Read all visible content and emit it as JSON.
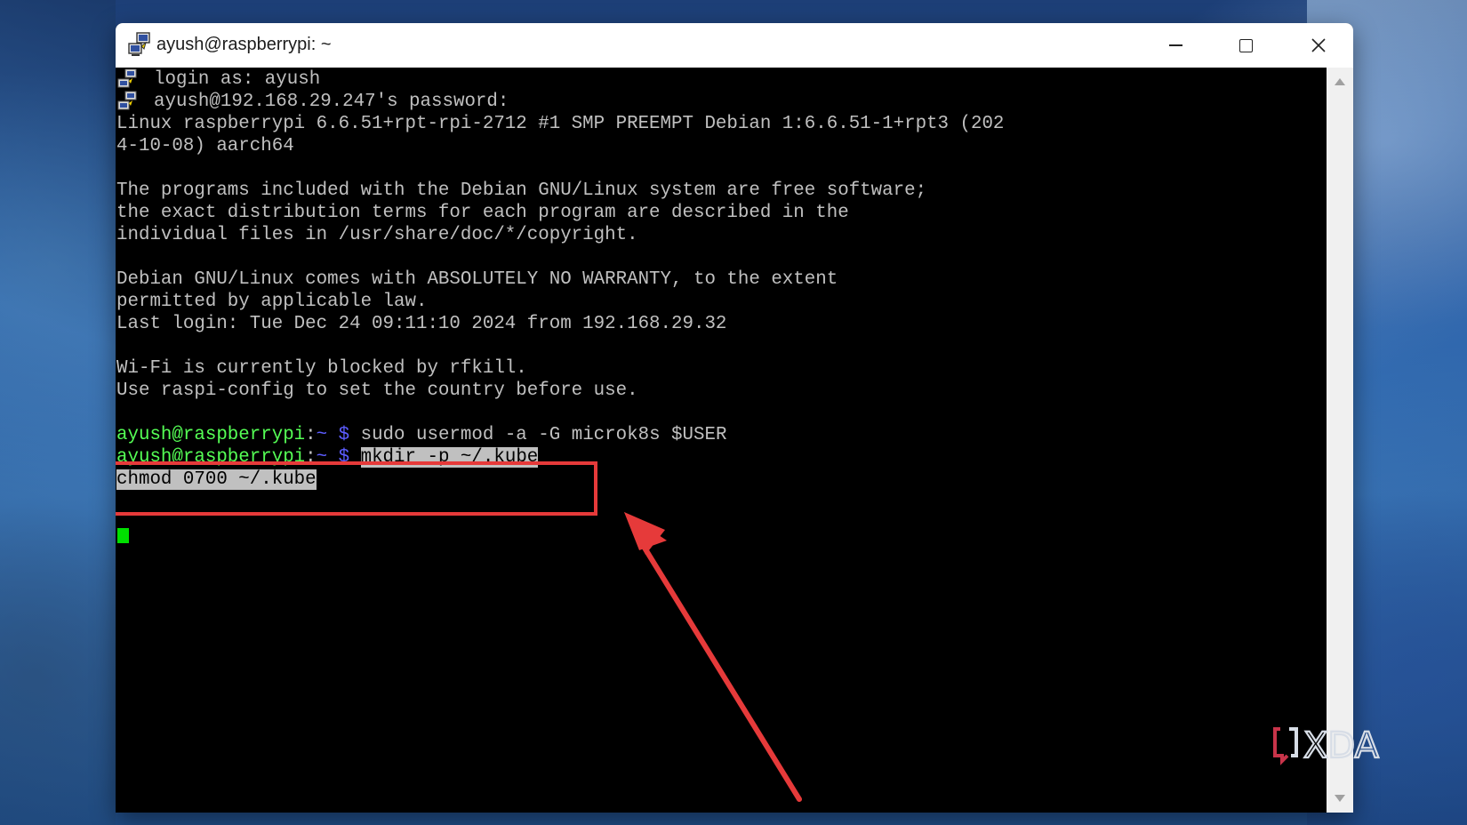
{
  "window": {
    "title": "ayush@raspberrypi: ~"
  },
  "terminal": {
    "lines": [
      "login as: ayush",
      "ayush@192.168.29.247's password:",
      "Linux raspberrypi 6.6.51+rpt-rpi-2712 #1 SMP PREEMPT Debian 1:6.6.51-1+rpt3 (202",
      "4-10-08) aarch64",
      "",
      "The programs included with the Debian GNU/Linux system are free software;",
      "the exact distribution terms for each program are described in the",
      "individual files in /usr/share/doc/*/copyright.",
      "",
      "Debian GNU/Linux comes with ABSOLUTELY NO WARRANTY, to the extent",
      "permitted by applicable law.",
      "Last login: Tue Dec 24 09:11:10 2024 from 192.168.29.32",
      "",
      "Wi-Fi is currently blocked by rfkill.",
      "Use raspi-config to set the country before use.",
      ""
    ],
    "prompt_user": "ayush@raspberrypi",
    "prompt_colon": ":",
    "prompt_path": "~ $",
    "previous_command": " sudo usermod -a -G microk8s $USER",
    "current_command": "mkdir -p ~/.kube",
    "continuation_line": "chmod 0700 ~/.kube"
  },
  "watermark": {
    "text": "XDA"
  },
  "colors": {
    "terminal_text": "#c0c0c0",
    "prompt_user": "#55ff55",
    "prompt_path": "#5c5cff",
    "cursor": "#00e000",
    "annotation": "#e63a3a"
  },
  "icons": {
    "app": "putty-icon",
    "minimize": "minimize-icon",
    "maximize": "maximize-icon",
    "close": "close-icon"
  }
}
